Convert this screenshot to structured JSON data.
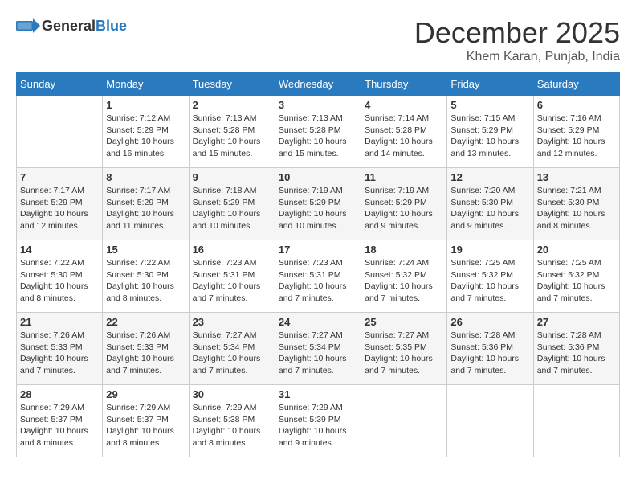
{
  "header": {
    "logo_general": "General",
    "logo_blue": "Blue",
    "month_year": "December 2025",
    "location": "Khem Karan, Punjab, India"
  },
  "days_of_week": [
    "Sunday",
    "Monday",
    "Tuesday",
    "Wednesday",
    "Thursday",
    "Friday",
    "Saturday"
  ],
  "weeks": [
    [
      {
        "day": "",
        "info": ""
      },
      {
        "day": "1",
        "info": "Sunrise: 7:12 AM\nSunset: 5:29 PM\nDaylight: 10 hours\nand 16 minutes."
      },
      {
        "day": "2",
        "info": "Sunrise: 7:13 AM\nSunset: 5:28 PM\nDaylight: 10 hours\nand 15 minutes."
      },
      {
        "day": "3",
        "info": "Sunrise: 7:13 AM\nSunset: 5:28 PM\nDaylight: 10 hours\nand 15 minutes."
      },
      {
        "day": "4",
        "info": "Sunrise: 7:14 AM\nSunset: 5:28 PM\nDaylight: 10 hours\nand 14 minutes."
      },
      {
        "day": "5",
        "info": "Sunrise: 7:15 AM\nSunset: 5:29 PM\nDaylight: 10 hours\nand 13 minutes."
      },
      {
        "day": "6",
        "info": "Sunrise: 7:16 AM\nSunset: 5:29 PM\nDaylight: 10 hours\nand 12 minutes."
      }
    ],
    [
      {
        "day": "7",
        "info": "Sunrise: 7:17 AM\nSunset: 5:29 PM\nDaylight: 10 hours\nand 12 minutes."
      },
      {
        "day": "8",
        "info": "Sunrise: 7:17 AM\nSunset: 5:29 PM\nDaylight: 10 hours\nand 11 minutes."
      },
      {
        "day": "9",
        "info": "Sunrise: 7:18 AM\nSunset: 5:29 PM\nDaylight: 10 hours\nand 10 minutes."
      },
      {
        "day": "10",
        "info": "Sunrise: 7:19 AM\nSunset: 5:29 PM\nDaylight: 10 hours\nand 10 minutes."
      },
      {
        "day": "11",
        "info": "Sunrise: 7:19 AM\nSunset: 5:29 PM\nDaylight: 10 hours\nand 9 minutes."
      },
      {
        "day": "12",
        "info": "Sunrise: 7:20 AM\nSunset: 5:30 PM\nDaylight: 10 hours\nand 9 minutes."
      },
      {
        "day": "13",
        "info": "Sunrise: 7:21 AM\nSunset: 5:30 PM\nDaylight: 10 hours\nand 8 minutes."
      }
    ],
    [
      {
        "day": "14",
        "info": "Sunrise: 7:22 AM\nSunset: 5:30 PM\nDaylight: 10 hours\nand 8 minutes."
      },
      {
        "day": "15",
        "info": "Sunrise: 7:22 AM\nSunset: 5:30 PM\nDaylight: 10 hours\nand 8 minutes."
      },
      {
        "day": "16",
        "info": "Sunrise: 7:23 AM\nSunset: 5:31 PM\nDaylight: 10 hours\nand 7 minutes."
      },
      {
        "day": "17",
        "info": "Sunrise: 7:23 AM\nSunset: 5:31 PM\nDaylight: 10 hours\nand 7 minutes."
      },
      {
        "day": "18",
        "info": "Sunrise: 7:24 AM\nSunset: 5:32 PM\nDaylight: 10 hours\nand 7 minutes."
      },
      {
        "day": "19",
        "info": "Sunrise: 7:25 AM\nSunset: 5:32 PM\nDaylight: 10 hours\nand 7 minutes."
      },
      {
        "day": "20",
        "info": "Sunrise: 7:25 AM\nSunset: 5:32 PM\nDaylight: 10 hours\nand 7 minutes."
      }
    ],
    [
      {
        "day": "21",
        "info": "Sunrise: 7:26 AM\nSunset: 5:33 PM\nDaylight: 10 hours\nand 7 minutes."
      },
      {
        "day": "22",
        "info": "Sunrise: 7:26 AM\nSunset: 5:33 PM\nDaylight: 10 hours\nand 7 minutes."
      },
      {
        "day": "23",
        "info": "Sunrise: 7:27 AM\nSunset: 5:34 PM\nDaylight: 10 hours\nand 7 minutes."
      },
      {
        "day": "24",
        "info": "Sunrise: 7:27 AM\nSunset: 5:34 PM\nDaylight: 10 hours\nand 7 minutes."
      },
      {
        "day": "25",
        "info": "Sunrise: 7:27 AM\nSunset: 5:35 PM\nDaylight: 10 hours\nand 7 minutes."
      },
      {
        "day": "26",
        "info": "Sunrise: 7:28 AM\nSunset: 5:36 PM\nDaylight: 10 hours\nand 7 minutes."
      },
      {
        "day": "27",
        "info": "Sunrise: 7:28 AM\nSunset: 5:36 PM\nDaylight: 10 hours\nand 7 minutes."
      }
    ],
    [
      {
        "day": "28",
        "info": "Sunrise: 7:29 AM\nSunset: 5:37 PM\nDaylight: 10 hours\nand 8 minutes."
      },
      {
        "day": "29",
        "info": "Sunrise: 7:29 AM\nSunset: 5:37 PM\nDaylight: 10 hours\nand 8 minutes."
      },
      {
        "day": "30",
        "info": "Sunrise: 7:29 AM\nSunset: 5:38 PM\nDaylight: 10 hours\nand 8 minutes."
      },
      {
        "day": "31",
        "info": "Sunrise: 7:29 AM\nSunset: 5:39 PM\nDaylight: 10 hours\nand 9 minutes."
      },
      {
        "day": "",
        "info": ""
      },
      {
        "day": "",
        "info": ""
      },
      {
        "day": "",
        "info": ""
      }
    ]
  ]
}
